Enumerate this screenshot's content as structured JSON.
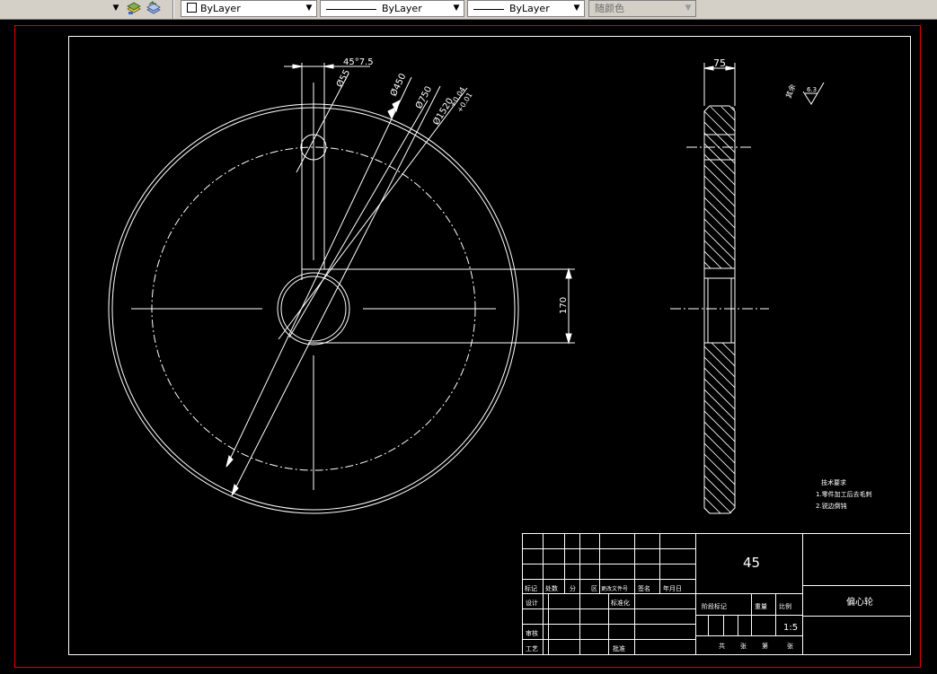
{
  "toolbar": {
    "color_combo": "ByLayer",
    "linetype_combo": "ByLayer",
    "lineweight_combo": "ByLayer",
    "plotstyle_combo": "随颜色"
  },
  "drawing": {
    "dims": {
      "taper": "45°7.5",
      "d55": "Ø55",
      "d450": "Ø450",
      "d750": "Ø750",
      "d1520": "Ø1520",
      "tol_upper": "+0.04",
      "tol_lower": "+0.01",
      "h170": "170",
      "w75": "75"
    },
    "roughness": {
      "text": "其余",
      "value": "6.3"
    },
    "notes": {
      "title": "技术要求",
      "line1": "1.零件加工后去毛刺",
      "line2": "2.锐边倒钝"
    },
    "title_block": {
      "material": "45",
      "part_name": "偏心轮",
      "scale": "1:5",
      "rev_headers": [
        "标记",
        "处数",
        "分",
        "区",
        "更改文件号",
        "签名",
        "年月日"
      ],
      "design": "设计",
      "standard": "标准化",
      "review": "审核",
      "process": "工艺",
      "approve": "批准",
      "stage_headers": [
        "阶段标记",
        "重量",
        "比例"
      ],
      "sheets": [
        "共",
        "张",
        "第",
        "张"
      ]
    }
  }
}
